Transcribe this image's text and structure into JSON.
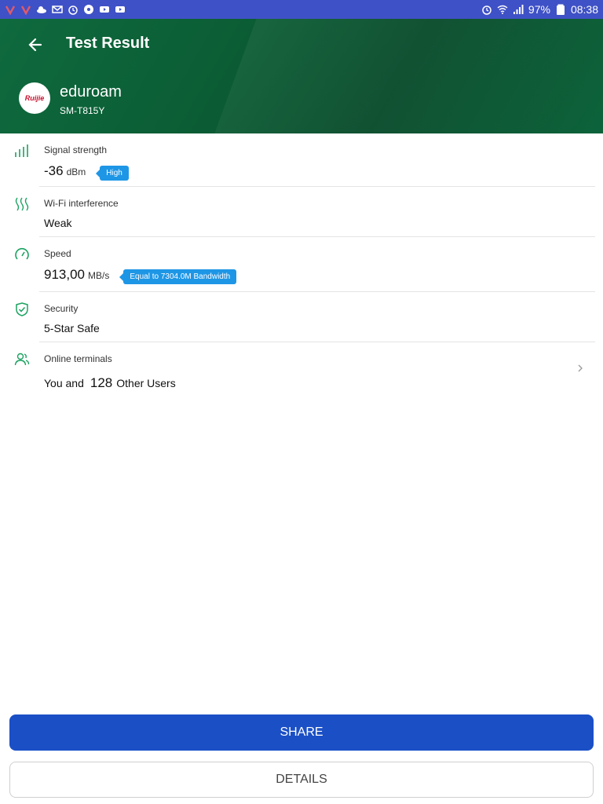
{
  "status_bar": {
    "battery": "97%",
    "time": "08:38",
    "left_icons": [
      "vivaldi-icon",
      "vivaldi-icon",
      "cloud-icon",
      "gmail-icon",
      "alarm-icon",
      "soccer-icon",
      "youtube-icon",
      "youtube-icon"
    ],
    "right_icons": [
      "alarm-icon",
      "wifi-icon",
      "signal-icon",
      "battery-icon"
    ]
  },
  "header": {
    "title": "Test Result",
    "ssid": "eduroam",
    "device": "SM-T815Y",
    "logo_text": "Ruijie"
  },
  "results": {
    "signal": {
      "label": "Signal strength",
      "value": "-36",
      "unit": "dBm",
      "badge": "High"
    },
    "interference": {
      "label": "Wi-Fi interference",
      "value": "Weak"
    },
    "speed": {
      "label": "Speed",
      "value": "913,00",
      "unit": "MB/s",
      "badge": "Equal to 7304.0M Bandwidth"
    },
    "security": {
      "label": "Security",
      "value": "5-Star Safe"
    },
    "terminals": {
      "label": "Online terminals",
      "prefix": "You and",
      "count": "128",
      "suffix": "Other Users"
    }
  },
  "buttons": {
    "share": "SHARE",
    "details": "DETAILS"
  },
  "colors": {
    "status_bar": "#3f51c6",
    "header_green": "#0b5c34",
    "accent_green": "#1aa260",
    "badge_blue": "#1e96e6",
    "share_blue": "#1a4fc6"
  }
}
